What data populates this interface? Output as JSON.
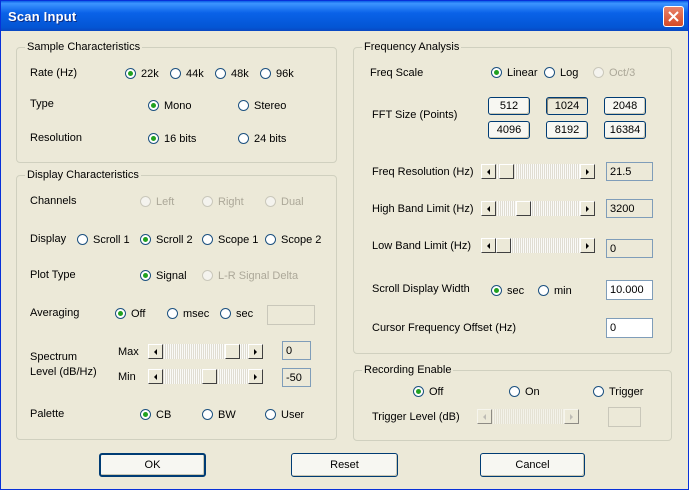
{
  "window": {
    "title": "Scan Input"
  },
  "sample": {
    "legend": "Sample Characteristics",
    "rate_label": "Rate (Hz)",
    "rate_options": [
      "22k",
      "44k",
      "48k",
      "96k"
    ],
    "rate_selected": "22k",
    "type_label": "Type",
    "type_options": [
      "Mono",
      "Stereo"
    ],
    "type_selected": "Mono",
    "resolution_label": "Resolution",
    "resolution_options": [
      "16 bits",
      "24 bits"
    ],
    "resolution_selected": "16 bits"
  },
  "display": {
    "legend": "Display Characteristics",
    "channels_label": "Channels",
    "channels_options": [
      "Left",
      "Right",
      "Dual"
    ],
    "display_label": "Display",
    "display_options": [
      "Scroll 1",
      "Scroll 2",
      "Scope 1",
      "Scope 2"
    ],
    "display_selected": "Scroll 2",
    "plot_label": "Plot Type",
    "plot_options": [
      "Signal",
      "L-R Signal Delta"
    ],
    "plot_selected": "Signal",
    "averaging_label": "Averaging",
    "averaging_options": [
      "Off",
      "msec",
      "sec"
    ],
    "averaging_selected": "Off",
    "averaging_value": "",
    "spectrum_label_1": "Spectrum",
    "spectrum_label_2": "Level (dB/Hz)",
    "max_label": "Max",
    "max_value": "0",
    "min_label": "Min",
    "min_value": "-50",
    "palette_label": "Palette",
    "palette_options": [
      "CB",
      "BW",
      "User"
    ],
    "palette_selected": "CB"
  },
  "freq": {
    "legend": "Frequency Analysis",
    "scale_label": "Freq Scale",
    "scale_options": [
      "Linear",
      "Log",
      "Oct/3"
    ],
    "scale_selected": "Linear",
    "fft_label": "FFT Size (Points)",
    "fft_sizes": [
      "512",
      "1024",
      "2048",
      "4096",
      "8192",
      "16384"
    ],
    "fft_selected": "1024",
    "resolution_label": "Freq Resolution (Hz)",
    "resolution_value": "21.5",
    "high_label": "High Band Limit (Hz)",
    "high_value": "3200",
    "low_label": "Low Band Limit (Hz)",
    "low_value": "0",
    "scroll_label": "Scroll Display Width",
    "scroll_units": [
      "sec",
      "min"
    ],
    "scroll_unit_selected": "sec",
    "scroll_value": "10.000",
    "cursor_label": "Cursor Frequency Offset (Hz)",
    "cursor_value": "0"
  },
  "recording": {
    "legend": "Recording Enable",
    "options": [
      "Off",
      "On",
      "Trigger"
    ],
    "selected": "Off",
    "trigger_label": "Trigger Level (dB)",
    "trigger_value": ""
  },
  "buttons": {
    "ok": "OK",
    "reset": "Reset",
    "cancel": "Cancel"
  }
}
